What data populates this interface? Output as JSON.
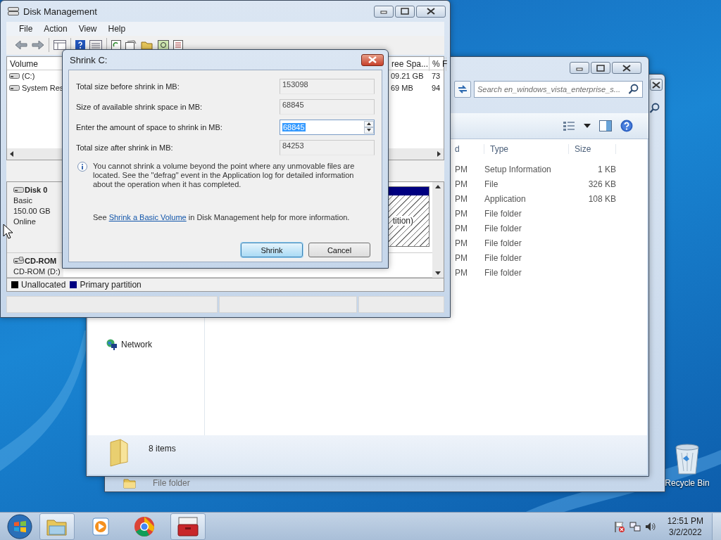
{
  "desktop": {
    "icons": [
      {
        "label": "Recycle Bin"
      }
    ]
  },
  "back_window": {
    "rows": [
      {
        "type": "File folder"
      }
    ]
  },
  "explorer": {
    "search": {
      "placeholder": "Search en_windows_vista_enterprise_s..."
    },
    "columns": [
      "d",
      "Type",
      "Size"
    ],
    "rows": [
      {
        "column_1": "PM",
        "type": "Setup Information",
        "size": "1 KB"
      },
      {
        "column_1": "PM",
        "type": "File",
        "size": "326 KB"
      },
      {
        "column_1": "PM",
        "type": "Application",
        "size": "108 KB"
      },
      {
        "column_1": "PM",
        "type": "File folder"
      },
      {
        "column_1": "PM",
        "type": "File folder"
      },
      {
        "column_1": "PM",
        "type": "File folder"
      },
      {
        "column_1": "PM",
        "type": "File folder"
      },
      {
        "column_1": "PM",
        "type": "File folder"
      }
    ],
    "nav_items": [
      {
        "label": "Network"
      }
    ],
    "status": "8 items"
  },
  "disk_management": {
    "title": "Disk Management",
    "menu": [
      "File",
      "Action",
      "View",
      "Help"
    ],
    "volume_columns": [
      "Volume",
      "ree Spa...",
      "% F"
    ],
    "volumes": [
      {
        "name": "(C:)",
        "free": "09.21 GB",
        "percent": "73"
      },
      {
        "name": "System Res",
        "free": "69 MB",
        "percent": "94"
      }
    ],
    "disks": [
      {
        "name": "Disk 0",
        "lines": [
          "Basic",
          "150.00 GB",
          "Online"
        ]
      },
      {
        "name": "CD-ROM",
        "lines": [
          "CD-ROM (D:)"
        ]
      }
    ],
    "partition_label": "tition)",
    "legend": [
      {
        "label": "Unallocated",
        "color": "#000000"
      },
      {
        "label": "Primary partition",
        "color": "#000080"
      }
    ]
  },
  "dialog": {
    "title": "Shrink C:",
    "fields": [
      {
        "label": "Total size before shrink in MB:",
        "value": "153098",
        "kind": "readonly"
      },
      {
        "label": "Size of available shrink space in MB:",
        "value": "68845",
        "kind": "readonly"
      },
      {
        "label": "Enter the amount of space to shrink in MB:",
        "value": "68845",
        "kind": "spin",
        "selected": true
      },
      {
        "label": "Total size after shrink in MB:",
        "value": "84253",
        "kind": "readonly"
      }
    ],
    "info": "You cannot shrink a volume beyond the point where any unmovable files are located. See the \"defrag\" event in the Application log for detailed information about the operation when it has completed.",
    "help": {
      "before": "See",
      "link": "Shrink a Basic Volume",
      "after": "in Disk Management help for more information."
    },
    "buttons": [
      {
        "label": "Shrink",
        "default": true
      },
      {
        "label": "Cancel",
        "default": false
      }
    ]
  },
  "taskbar": {
    "apps": [
      {
        "kind": "folders",
        "active": true
      },
      {
        "kind": "media",
        "active": false
      },
      {
        "kind": "browser",
        "active": false
      },
      {
        "kind": "toolbox",
        "active": true
      }
    ],
    "clock": {
      "time": "12:51 PM",
      "date": "3/2/2022"
    }
  }
}
